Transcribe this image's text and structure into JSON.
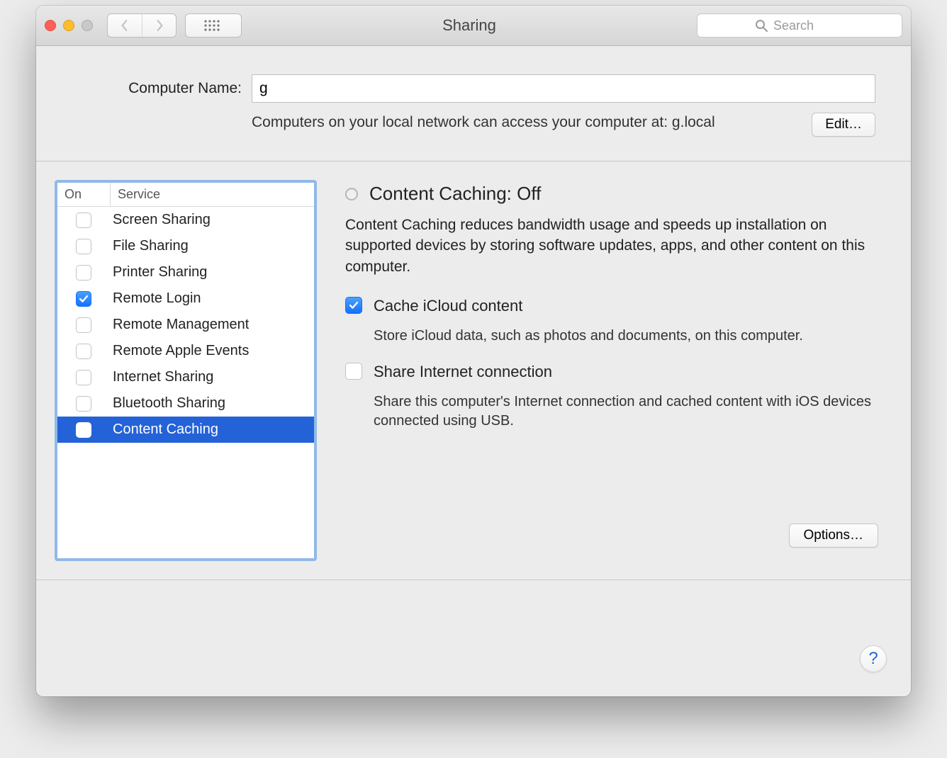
{
  "titlebar": {
    "title": "Sharing",
    "search_placeholder": "Search"
  },
  "computer_name": {
    "label": "Computer Name:",
    "value": "g",
    "hint": "Computers on your local network can access your computer at: g.local",
    "edit_label": "Edit…"
  },
  "services": {
    "columns": {
      "on": "On",
      "service": "Service"
    },
    "items": [
      {
        "label": "Screen Sharing",
        "on": false,
        "selected": false
      },
      {
        "label": "File Sharing",
        "on": false,
        "selected": false
      },
      {
        "label": "Printer Sharing",
        "on": false,
        "selected": false
      },
      {
        "label": "Remote Login",
        "on": true,
        "selected": false
      },
      {
        "label": "Remote Management",
        "on": false,
        "selected": false
      },
      {
        "label": "Remote Apple Events",
        "on": false,
        "selected": false
      },
      {
        "label": "Internet Sharing",
        "on": false,
        "selected": false
      },
      {
        "label": "Bluetooth Sharing",
        "on": false,
        "selected": false
      },
      {
        "label": "Content Caching",
        "on": false,
        "selected": true
      }
    ]
  },
  "detail": {
    "heading": "Content Caching: Off",
    "desc": "Content Caching reduces bandwidth usage and speeds up installation on supported devices by storing software updates, apps, and other content on this computer.",
    "options_label": "Options…",
    "opts": [
      {
        "title": "Cache iCloud content",
        "sub": "Store iCloud data, such as photos and documents, on this computer.",
        "checked": true
      },
      {
        "title": "Share Internet connection",
        "sub": "Share this computer's Internet connection and cached content with iOS devices connected using USB.",
        "checked": false
      }
    ]
  },
  "help_label": "?"
}
